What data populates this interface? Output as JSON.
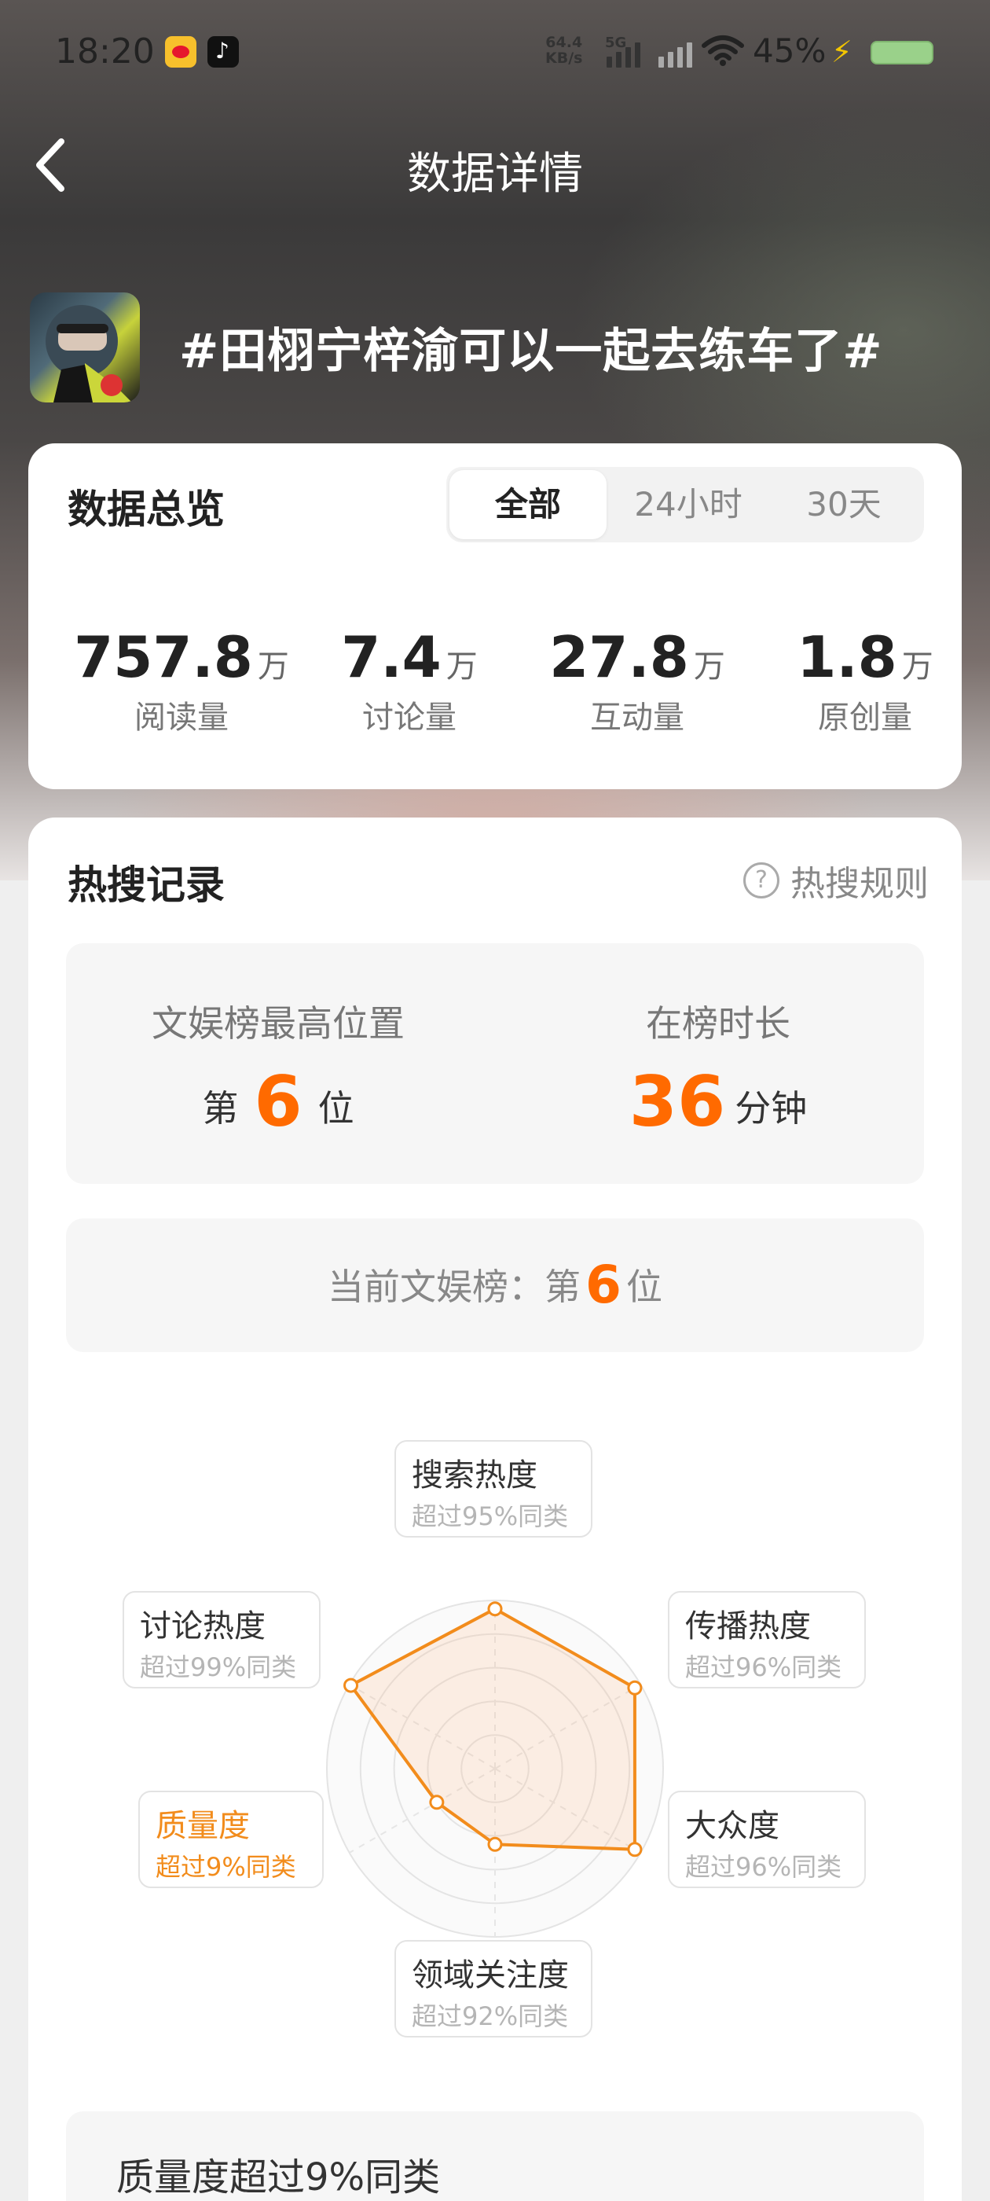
{
  "status_bar": {
    "time": "18:20",
    "net_speed_value": "64.4",
    "net_speed_unit": "KB/s",
    "network_type": "5G",
    "battery": "45%"
  },
  "nav": {
    "title": "数据详情"
  },
  "topic": {
    "title": "#田栩宁梓渝可以一起去练车了#"
  },
  "overview": {
    "title": "数据总览",
    "tabs": [
      "全部",
      "24小时",
      "30天"
    ],
    "active_tab": "全部",
    "stats": [
      {
        "value": "757.8",
        "unit": "万",
        "label": "阅读量"
      },
      {
        "value": "7.4",
        "unit": "万",
        "label": "讨论量"
      },
      {
        "value": "27.8",
        "unit": "万",
        "label": "互动量"
      },
      {
        "value": "1.8",
        "unit": "万",
        "label": "原创量"
      }
    ]
  },
  "hot_search": {
    "title": "热搜记录",
    "rule_link": "热搜规则",
    "best_position": {
      "label": "文娱榜最高位置",
      "prefix": "第",
      "value": "6",
      "suffix": "位"
    },
    "duration": {
      "label": "在榜时长",
      "value": "36",
      "suffix": "分钟"
    },
    "current": {
      "prefix": "当前文娱榜：第",
      "value": "6",
      "suffix": "位"
    },
    "radar": {
      "accent_color": "#f28c1c",
      "axes": [
        {
          "name": "搜索热度",
          "sub": "超过95%同类",
          "score": 0.95
        },
        {
          "name": "传播热度",
          "sub": "超过96%同类",
          "score": 0.96
        },
        {
          "name": "大众度",
          "sub": "超过96%同类",
          "score": 0.96
        },
        {
          "name": "领域关注度",
          "sub": "超过92%同类",
          "score": 0.45
        },
        {
          "name": "质量度",
          "sub": "超过9%同类",
          "score": 0.4
        },
        {
          "name": "讨论热度",
          "sub": "超过99%同类",
          "score": 0.99
        }
      ]
    },
    "quality_title": "质量度超过9%同类"
  }
}
